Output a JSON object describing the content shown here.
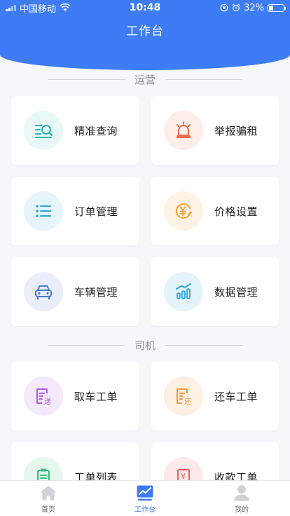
{
  "status_bar": {
    "carrier": "中国移动",
    "time": "10:48",
    "battery": "32%"
  },
  "header": {
    "title": "工作台"
  },
  "sections": [
    {
      "title": "运营",
      "items": [
        {
          "label": "精准查询",
          "icon": "search-list-icon",
          "color": "#1fb7b0",
          "bg": "#e7f8f7"
        },
        {
          "label": "举报骗租",
          "icon": "alarm-light-icon",
          "color": "#f06a4c",
          "bg": "#fdeeea"
        },
        {
          "label": "订单管理",
          "icon": "list-icon",
          "color": "#25a9d6",
          "bg": "#e6f5fa"
        },
        {
          "label": "价格设置",
          "icon": "yuan-circle-icon",
          "color": "#f4a43b",
          "bg": "#fef3e4"
        },
        {
          "label": "车辆管理",
          "icon": "car-icon",
          "color": "#4a7ad4",
          "bg": "#e9eefa"
        },
        {
          "label": "数据管理",
          "icon": "bar-chart-icon",
          "color": "#2aa5e0",
          "bg": "#e4f4fb"
        }
      ]
    },
    {
      "title": "司机",
      "items": [
        {
          "label": "取车工单",
          "icon": "pickup-order-icon",
          "badge": "送",
          "color": "#b65ce0",
          "bg": "#f5eafb"
        },
        {
          "label": "还车工单",
          "icon": "return-order-icon",
          "badge": "还",
          "color": "#f49a3e",
          "bg": "#fef0e2"
        },
        {
          "label": "工单列表",
          "icon": "clipboard-icon",
          "color": "#2fc17a",
          "bg": "#e4f8ee"
        },
        {
          "label": "收款工单",
          "icon": "receipt-icon",
          "badge": "¥",
          "color": "#ef5f5f",
          "bg": "#fde9e9"
        }
      ]
    }
  ],
  "tabbar": {
    "items": [
      {
        "label": "首页",
        "icon": "home-icon"
      },
      {
        "label": "工作台",
        "icon": "workbench-chart-icon",
        "active": true
      },
      {
        "label": "我的",
        "icon": "profile-icon"
      }
    ]
  },
  "colors": {
    "primary": "#3d7cf5",
    "background": "#f5f7fb"
  }
}
